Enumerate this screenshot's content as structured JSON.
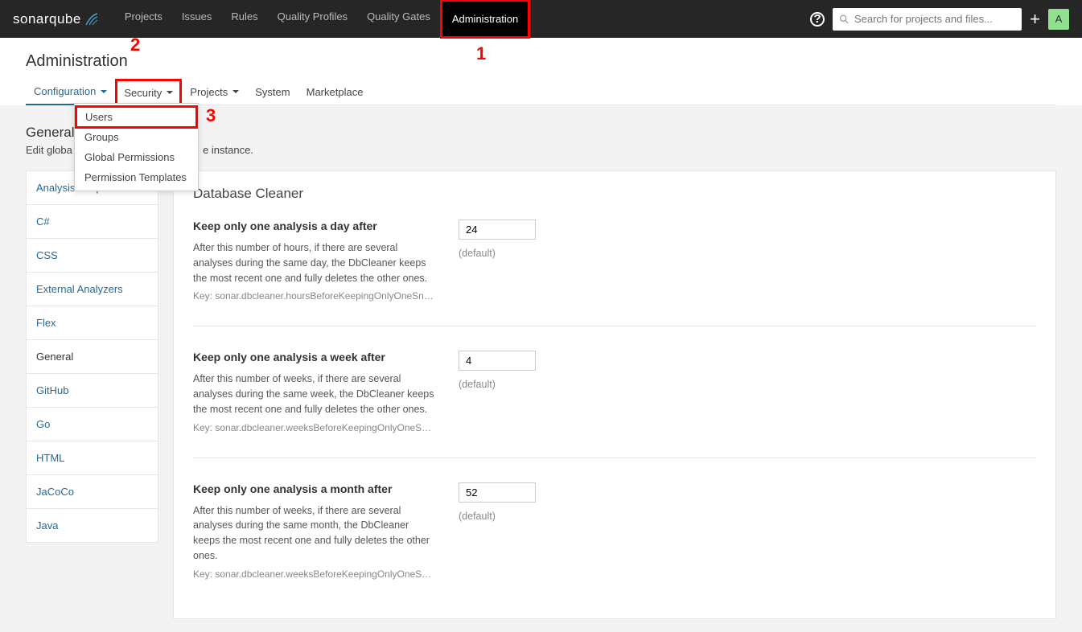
{
  "topnav": {
    "logo": "sonarqube",
    "items": [
      "Projects",
      "Issues",
      "Rules",
      "Quality Profiles",
      "Quality Gates",
      "Administration"
    ],
    "search_placeholder": "Search for projects and files...",
    "avatar": "A"
  },
  "annotations": {
    "n1": "1",
    "n2": "2",
    "n3": "3"
  },
  "subhead": {
    "title": "Administration",
    "tabs": [
      "Configuration",
      "Security",
      "Projects",
      "System",
      "Marketplace"
    ]
  },
  "dropdown": {
    "items": [
      "Users",
      "Groups",
      "Global Permissions",
      "Permission Templates"
    ]
  },
  "section": {
    "title": "General",
    "desc_prefix": "Edit globa",
    "desc_suffix": "e instance."
  },
  "categories": [
    "Analysis Scope",
    "C#",
    "CSS",
    "External Analyzers",
    "Flex",
    "General",
    "GitHub",
    "Go",
    "HTML",
    "JaCoCo",
    "Java"
  ],
  "panel": {
    "heading": "Database Cleaner",
    "settings": [
      {
        "title": "Keep only one analysis a day after",
        "desc": "After this number of hours, if there are several analyses during the same day, the DbCleaner keeps the most recent one and fully deletes the other ones.",
        "key": "Key: sonar.dbcleaner.hoursBeforeKeepingOnlyOneSn…",
        "value": "24",
        "default": "(default)"
      },
      {
        "title": "Keep only one analysis a week after",
        "desc": "After this number of weeks, if there are several analyses during the same week, the DbCleaner keeps the most recent one and fully deletes the other ones.",
        "key": "Key: sonar.dbcleaner.weeksBeforeKeepingOnlyOneS…",
        "value": "4",
        "default": "(default)"
      },
      {
        "title": "Keep only one analysis a month after",
        "desc": "After this number of weeks, if there are several analyses during the same month, the DbCleaner keeps the most recent one and fully deletes the other ones.",
        "key": "Key: sonar.dbcleaner.weeksBeforeKeepingOnlyOneS…",
        "value": "52",
        "default": "(default)"
      }
    ]
  }
}
